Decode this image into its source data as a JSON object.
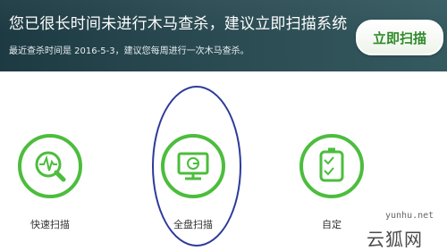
{
  "header": {
    "title": "您已很长时间未进行木马查杀，建议立即扫描系统",
    "subtitle": "最近查杀时间是 2016-5-3，建议您每周进行一次木马查杀。",
    "scan_button_label": "立即扫描"
  },
  "options": [
    {
      "label": "快速扫描",
      "icon": "quick-scan-icon"
    },
    {
      "label": "全盘扫描",
      "icon": "full-scan-icon"
    },
    {
      "label": "自定",
      "icon": "custom-scan-icon"
    }
  ],
  "watermark": {
    "url": "yunhu.net",
    "brand": "云狐网"
  },
  "colors": {
    "accent_green": "#4cbd3d",
    "header_bg": "#2a4a52",
    "annotation_oval": "#2c3a9a"
  }
}
